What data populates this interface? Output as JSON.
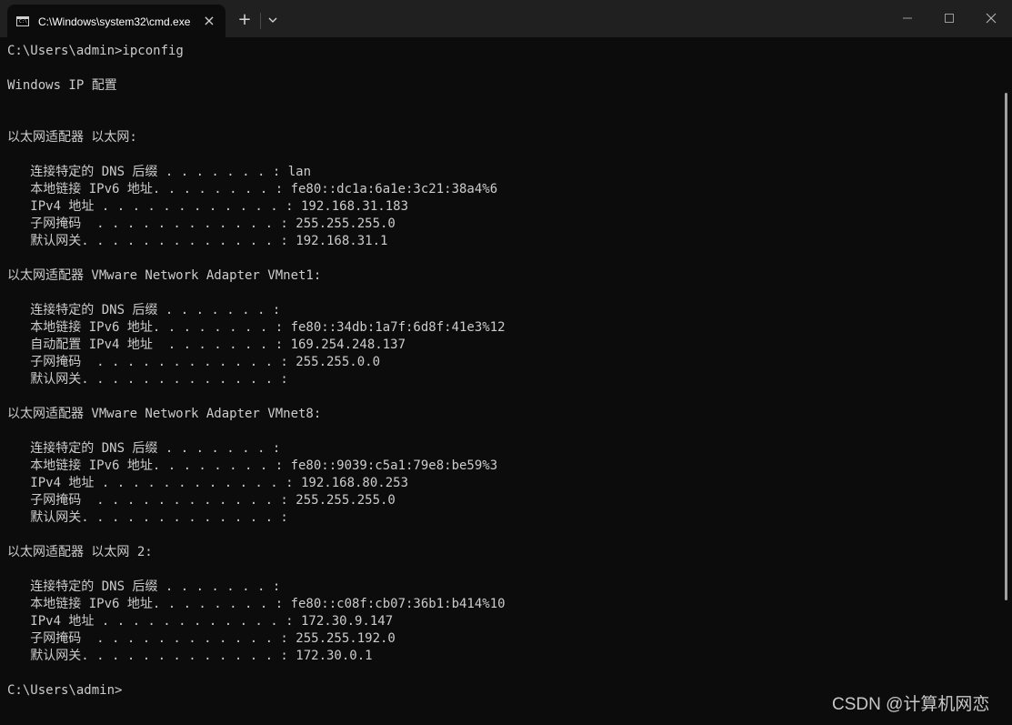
{
  "window": {
    "tab_title": "C:\\Windows\\system32\\cmd.exe",
    "tab_close_glyph": "×",
    "new_tab_glyph": "+",
    "tab_icon_glyph": "C:\\"
  },
  "terminal": {
    "lines": [
      "C:\\Users\\admin>ipconfig",
      "",
      "Windows IP 配置",
      "",
      "",
      "以太网适配器 以太网:",
      "",
      "   连接特定的 DNS 后缀 . . . . . . . : lan",
      "   本地链接 IPv6 地址. . . . . . . . : fe80::dc1a:6a1e:3c21:38a4%6",
      "   IPv4 地址 . . . . . . . . . . . . : 192.168.31.183",
      "   子网掩码  . . . . . . . . . . . . : 255.255.255.0",
      "   默认网关. . . . . . . . . . . . . : 192.168.31.1",
      "",
      "以太网适配器 VMware Network Adapter VMnet1:",
      "",
      "   连接特定的 DNS 后缀 . . . . . . . :",
      "   本地链接 IPv6 地址. . . . . . . . : fe80::34db:1a7f:6d8f:41e3%12",
      "   自动配置 IPv4 地址  . . . . . . . : 169.254.248.137",
      "   子网掩码  . . . . . . . . . . . . : 255.255.0.0",
      "   默认网关. . . . . . . . . . . . . :",
      "",
      "以太网适配器 VMware Network Adapter VMnet8:",
      "",
      "   连接特定的 DNS 后缀 . . . . . . . :",
      "   本地链接 IPv6 地址. . . . . . . . : fe80::9039:c5a1:79e8:be59%3",
      "   IPv4 地址 . . . . . . . . . . . . : 192.168.80.253",
      "   子网掩码  . . . . . . . . . . . . : 255.255.255.0",
      "   默认网关. . . . . . . . . . . . . :",
      "",
      "以太网适配器 以太网 2:",
      "",
      "   连接特定的 DNS 后缀 . . . . . . . :",
      "   本地链接 IPv6 地址. . . . . . . . : fe80::c08f:cb07:36b1:b414%10",
      "   IPv4 地址 . . . . . . . . . . . . : 172.30.9.147",
      "   子网掩码  . . . . . . . . . . . . : 255.255.192.0",
      "   默认网关. . . . . . . . . . . . . : 172.30.0.1",
      "",
      "C:\\Users\\admin>"
    ]
  },
  "watermark": "CSDN @计算机网恋",
  "colors": {
    "terminal_bg": "#0c0c0c",
    "terminal_fg": "#cccccc",
    "titlebar_bg": "#202020"
  }
}
